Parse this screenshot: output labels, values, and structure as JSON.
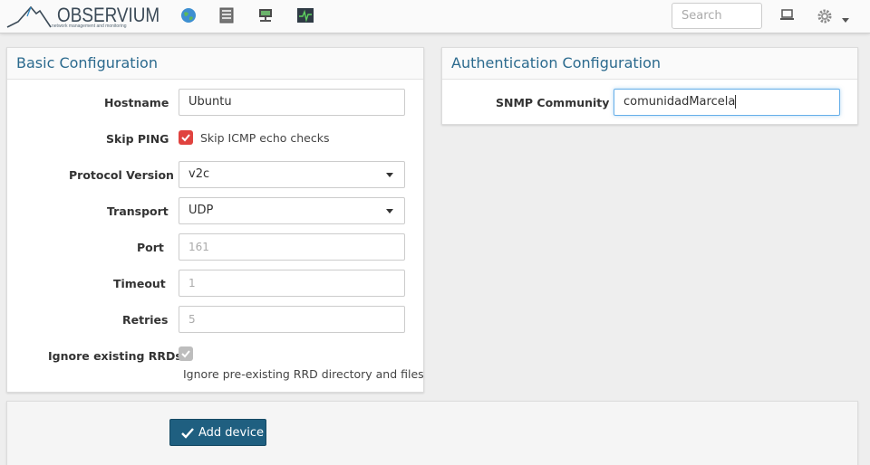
{
  "brand": {
    "name": "OBSERVIUM",
    "tagline": "network management and monitoring"
  },
  "nav": {
    "icons": [
      "globe-icon",
      "server-rack-icon",
      "network-device-icon",
      "health-monitor-icon"
    ],
    "search_placeholder": "Search",
    "right_icons": [
      "laptop-icon",
      "gear-icon"
    ]
  },
  "basic": {
    "title": "Basic Configuration",
    "hostname_label": "Hostname",
    "hostname_value": "Ubuntu",
    "skip_ping_label": "Skip PING",
    "skip_ping_text": "Skip ICMP echo checks",
    "skip_ping_checked": true,
    "protocol_label": "Protocol Version",
    "protocol_value": "v2c",
    "transport_label": "Transport",
    "transport_value": "UDP",
    "port_label": "Port",
    "port_placeholder": "161",
    "timeout_label": "Timeout",
    "timeout_placeholder": "1",
    "retries_label": "Retries",
    "retries_placeholder": "5",
    "ignore_rrd_label": "Ignore existing RRDs",
    "ignore_rrd_help": "Ignore pre-existing RRD directory and files"
  },
  "auth": {
    "title": "Authentication Configuration",
    "community_label": "SNMP Community",
    "community_value": "comunidadMarcela"
  },
  "actions": {
    "add_label": "Add device"
  },
  "colors": {
    "accent": "#2b6a8e",
    "button": "#1f5f80",
    "checkbox": "#e0433f"
  }
}
